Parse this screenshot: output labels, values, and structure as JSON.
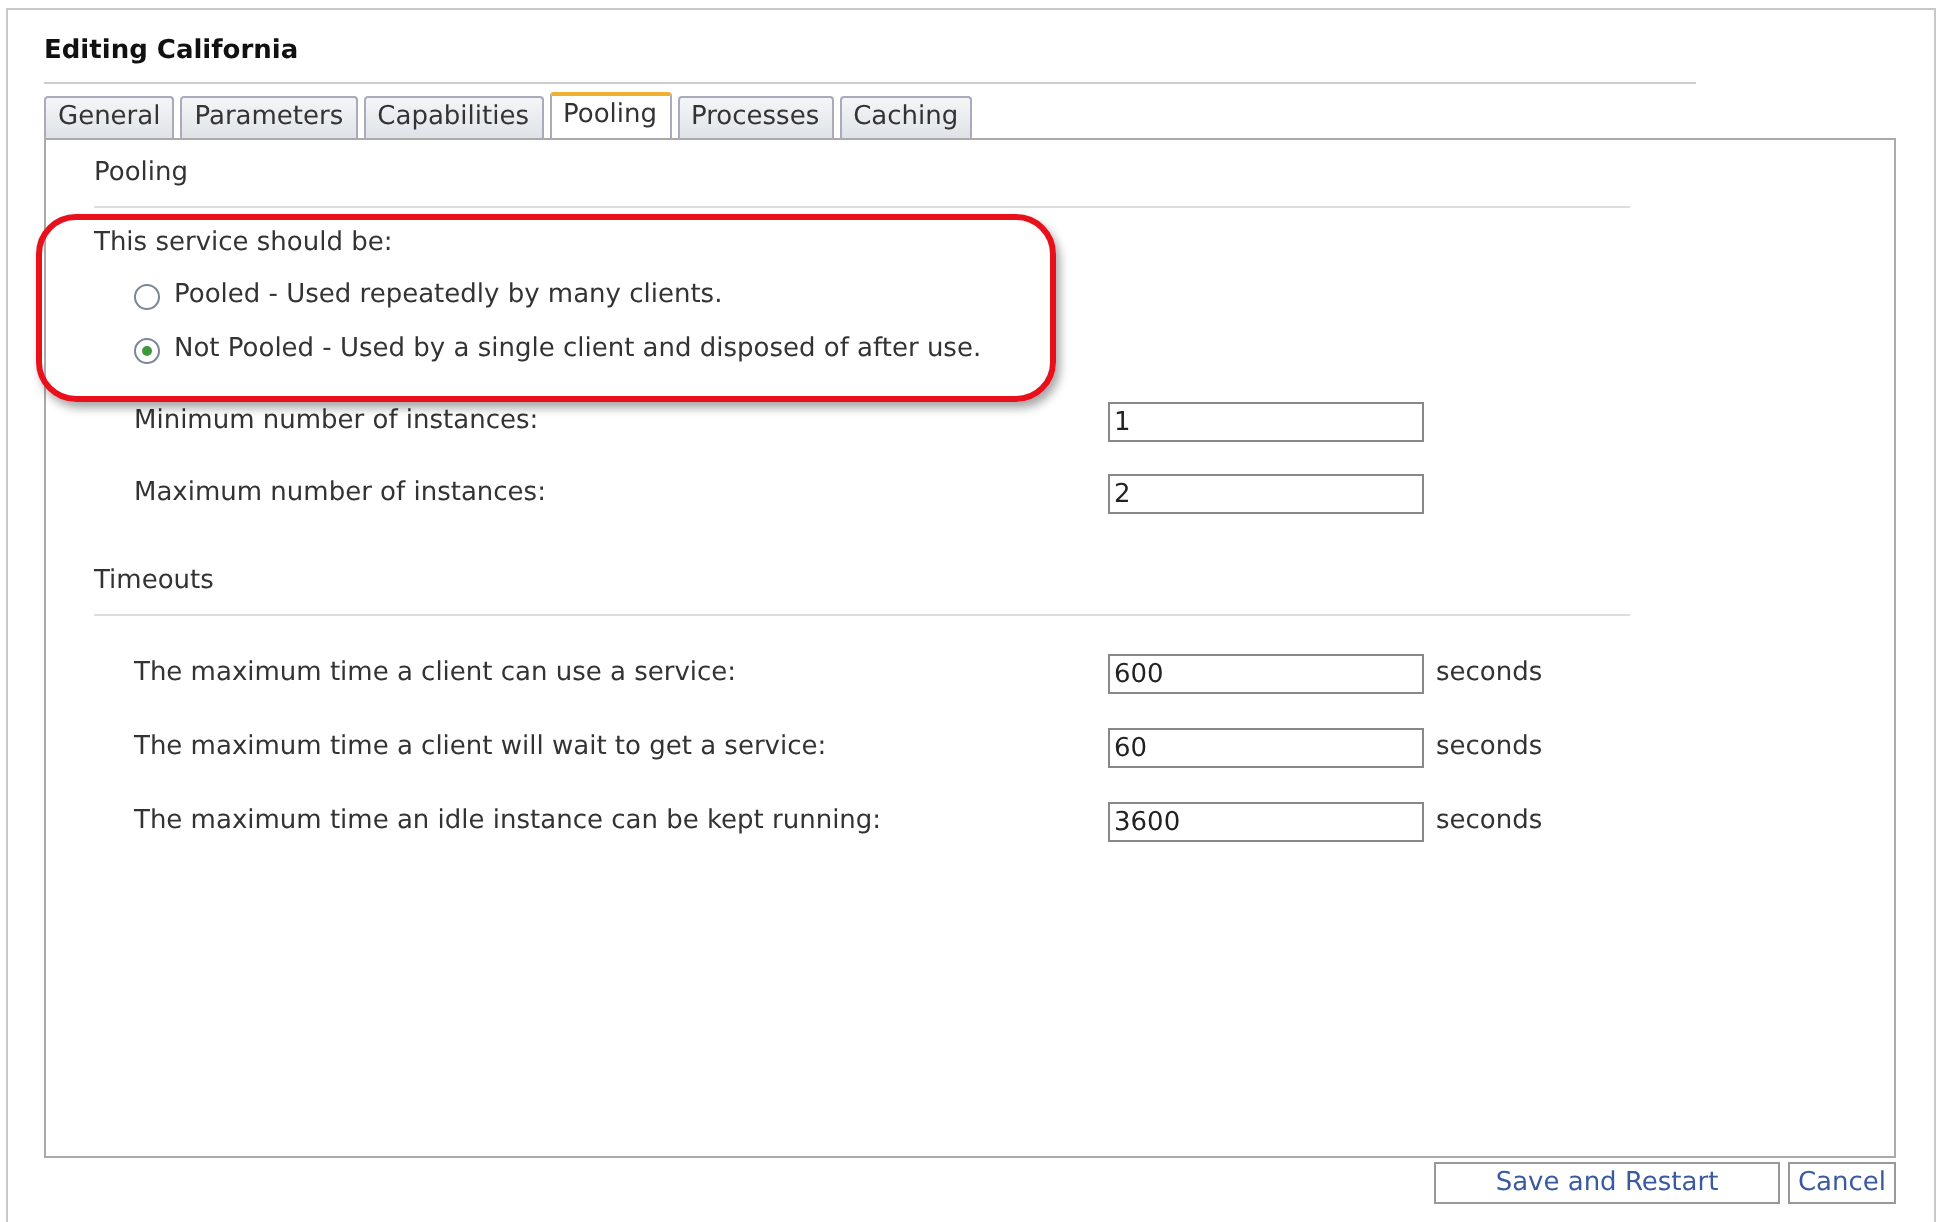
{
  "window": {
    "title": "Editing California"
  },
  "tabs": [
    {
      "label": "General",
      "selected": false
    },
    {
      "label": "Parameters",
      "selected": false
    },
    {
      "label": "Capabilities",
      "selected": false
    },
    {
      "label": "Pooling",
      "selected": true
    },
    {
      "label": "Processes",
      "selected": false
    },
    {
      "label": "Caching",
      "selected": false
    }
  ],
  "pooling": {
    "heading": "Pooling",
    "prompt": "This service should be:",
    "options": [
      {
        "label": "Pooled - Used repeatedly by many clients.",
        "selected": false
      },
      {
        "label": "Not Pooled - Used by a single client and disposed of after use.",
        "selected": true
      }
    ],
    "fields": [
      {
        "label": "Minimum number of instances:",
        "value": "1"
      },
      {
        "label": "Maximum number of instances:",
        "value": "2"
      }
    ]
  },
  "timeouts": {
    "heading": "Timeouts",
    "fields": [
      {
        "label": "The maximum time a client can use a service:",
        "value": "600",
        "unit": "seconds"
      },
      {
        "label": "The maximum time a client will wait to get a service:",
        "value": "60",
        "unit": "seconds"
      },
      {
        "label": "The maximum time an idle instance can be kept running:",
        "value": "3600",
        "unit": "seconds"
      }
    ]
  },
  "buttons": [
    "Save and Restart",
    "Cancel"
  ]
}
